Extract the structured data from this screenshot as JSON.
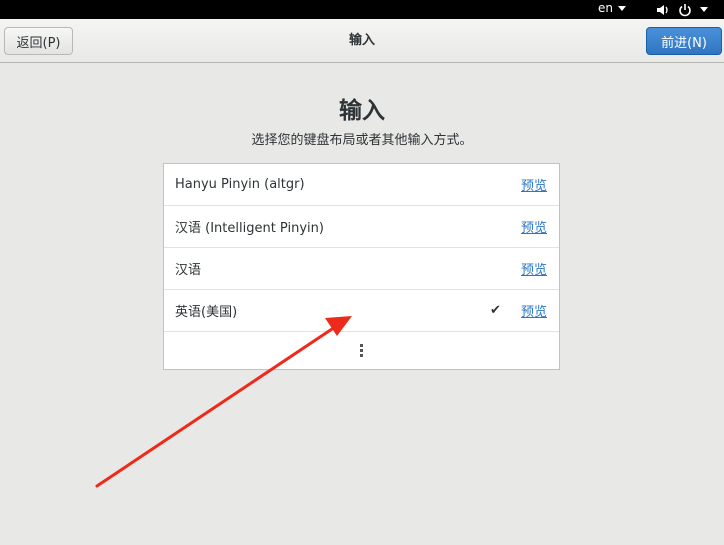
{
  "topbar": {
    "language": "en",
    "volume_icon": "speaker-icon",
    "power_icon": "power-icon"
  },
  "header": {
    "back_label": "返回(P)",
    "title": "输入",
    "next_label": "前进(N)"
  },
  "main": {
    "title": "输入",
    "subtitle": "选择您的键盘布局或者其他输入方式。",
    "input_methods": [
      {
        "label": "Hanyu Pinyin (altgr)",
        "selected": false,
        "preview": "预览"
      },
      {
        "label": "汉语 (Intelligent Pinyin)",
        "selected": false,
        "preview": "预览"
      },
      {
        "label": "汉语",
        "selected": false,
        "preview": "预览"
      },
      {
        "label": "英语(美国)",
        "selected": true,
        "preview": "预览"
      }
    ],
    "check_mark": "✔",
    "more_icon": "more-vertical-icon"
  },
  "colors": {
    "accent": "#2f75c2",
    "link": "#2a76c6",
    "annotation_arrow": "#ee2a1b"
  }
}
